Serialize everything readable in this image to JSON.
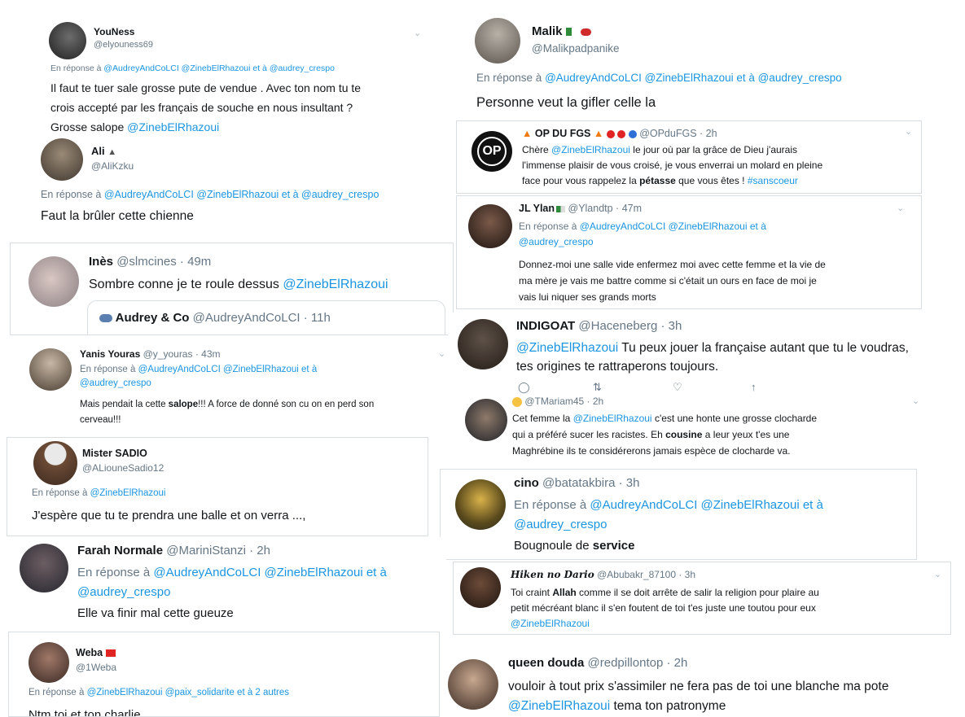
{
  "mention": "@ZinebElRhazoui",
  "tweets": {
    "youness": {
      "name": "YouNess",
      "handle": "@elyouness69",
      "reply_prefix": "En réponse à ",
      "reply_mentions": "@AudreyAndCoLCI @ZinebElRhazoui et à @audrey_crespo",
      "line1": "Il faut te tuer sale grosse pute de vendue . Avec ton nom tu te",
      "line2": "crois accepté par les français de souche en nous insultant ?",
      "line3": "Grosse salope "
    },
    "malik": {
      "name": "Malik",
      "handle": "@Malikpadpanike",
      "reply_prefix": "En réponse à ",
      "reply_mentions": "@AudreyAndCoLCI @ZinebElRhazoui et à @audrey_crespo",
      "line1": "Personne veut la gifler celle la"
    },
    "ali": {
      "name": "Ali",
      "handle": "@AliKzku",
      "reply_prefix": "En réponse à ",
      "reply_mentions": "@AudreyAndCoLCI @ZinebElRhazoui et à @audrey_crespo",
      "line1": "Faut la brûler cette chienne"
    },
    "opdufgs": {
      "name": "OP DU FGS",
      "handle": "@OPduFGS · 2h",
      "avatar_text": "OP",
      "line1_a": "Chère ",
      "line1_b": " le jour où par la grâce de Dieu j'aurais",
      "line2": "l'immense plaisir de vous croisé, je vous enverrai un molard en pleine",
      "line3_a": "face pour vous rappelez la ",
      "line3_bold": "pétasse",
      "line3_b": " que vous êtes ! ",
      "hashtag": "#sanscoeur"
    },
    "jlylan": {
      "name": "JL Ylan",
      "handle": "@Ylandtp · 47m",
      "reply_prefix": "En réponse à ",
      "reply_mentions1": "@AudreyAndCoLCI @ZinebElRhazoui et à",
      "reply_mentions2": "@audrey_crespo",
      "line1": "Donnez-moi une salle vide enfermez moi avec cette femme et la vie de",
      "line2": "ma mère je vais me battre comme si c'était un ours en face de moi je",
      "line3": "vais lui niquer ses grands morts"
    },
    "ines": {
      "name": "Inès",
      "handle": "@slmcines · 49m",
      "line1": "Sombre conne je te roule dessus ",
      "quote_name": "Audrey & Co",
      "quote_handle": "@AudreyAndCoLCI · 11h"
    },
    "indigoat": {
      "name": "INDIGOAT",
      "handle": "@Haceneberg · 3h",
      "line1_b": " Tu peux jouer la française autant que tu le voudras,",
      "line2": "tes origines te rattraperons toujours."
    },
    "yanis": {
      "name": "Yanis Youras",
      "handle": "@y_youras · 43m",
      "reply_prefix": "En réponse à ",
      "reply_mentions1": "@AudreyAndCoLCI @ZinebElRhazoui et à",
      "reply_mentions2": "@audrey_crespo",
      "line1_a": "Mais pendait la cette ",
      "line1_bold": "salope",
      "line1_b": "!!! A force de donné son cu on en perd son",
      "line2": "cerveau!!!"
    },
    "tmariam": {
      "handle": "@TMariam45 · 2h",
      "line1_a": "Cet femme la ",
      "line1_b": " c'est une honte une grosse clocharde",
      "line2": "qui a préféré sucer les racistes. Eh ",
      "line2_bold": "cousine",
      "line2_b": " a leur yeux t'es une",
      "line3": "Maghrébine ils te considérerons jamais espèce de clocharde va."
    },
    "sadio": {
      "name": "Mister SADIO",
      "handle": "@ALiouneSadio12",
      "reply_prefix": "En réponse à ",
      "line1": "J'espère que tu te prendra une balle et on verra ...,"
    },
    "cino": {
      "name": "cino",
      "handle": "@batatakbira · 3h",
      "reply_prefix": "En réponse à ",
      "reply_mentions1": "@AudreyAndCoLCI @ZinebElRhazoui et à",
      "reply_mentions2": "@audrey_crespo",
      "line1_a": "Bougnoule de ",
      "line1_bold": "service"
    },
    "farah": {
      "name": "Farah Normale",
      "handle": "@MariniStanzi · 2h",
      "reply_prefix": "En réponse à ",
      "reply_mentions1": "@AudreyAndCoLCI @ZinebElRhazoui et à",
      "reply_mentions2": "@audrey_crespo",
      "line1": "Elle va finir mal cette gueuze"
    },
    "hiken": {
      "name": "Hiken no Dario",
      "handle": "@Abubakr_87100 · 3h",
      "line1_a": "Toi craint ",
      "line1_bold": "Allah",
      "line1_b": " comme il se doit arrête de salir la religion pour plaire au",
      "line2": "petit mécréant blanc il s'en foutent de toi t'es juste une toutou pour eux"
    },
    "weba": {
      "name": "Weba",
      "handle": "@1Weba",
      "reply_prefix": "En réponse à ",
      "reply_mentions": "@ZinebElRhazoui @paix_solidarite et à 2 autres",
      "line1": "Ntm toi et ton charlie"
    },
    "queen": {
      "name": "queen douda",
      "handle": "@redpillontop · 2h",
      "line1": "vouloir à tout prix s'assimiler ne fera pas de toi une blanche ma pote",
      "line2_b": " tema ton patronyme"
    }
  },
  "colors": {
    "mention_blue": "#1b95e0",
    "secondary_gray": "#657786",
    "border_gray": "#d9dee2"
  }
}
